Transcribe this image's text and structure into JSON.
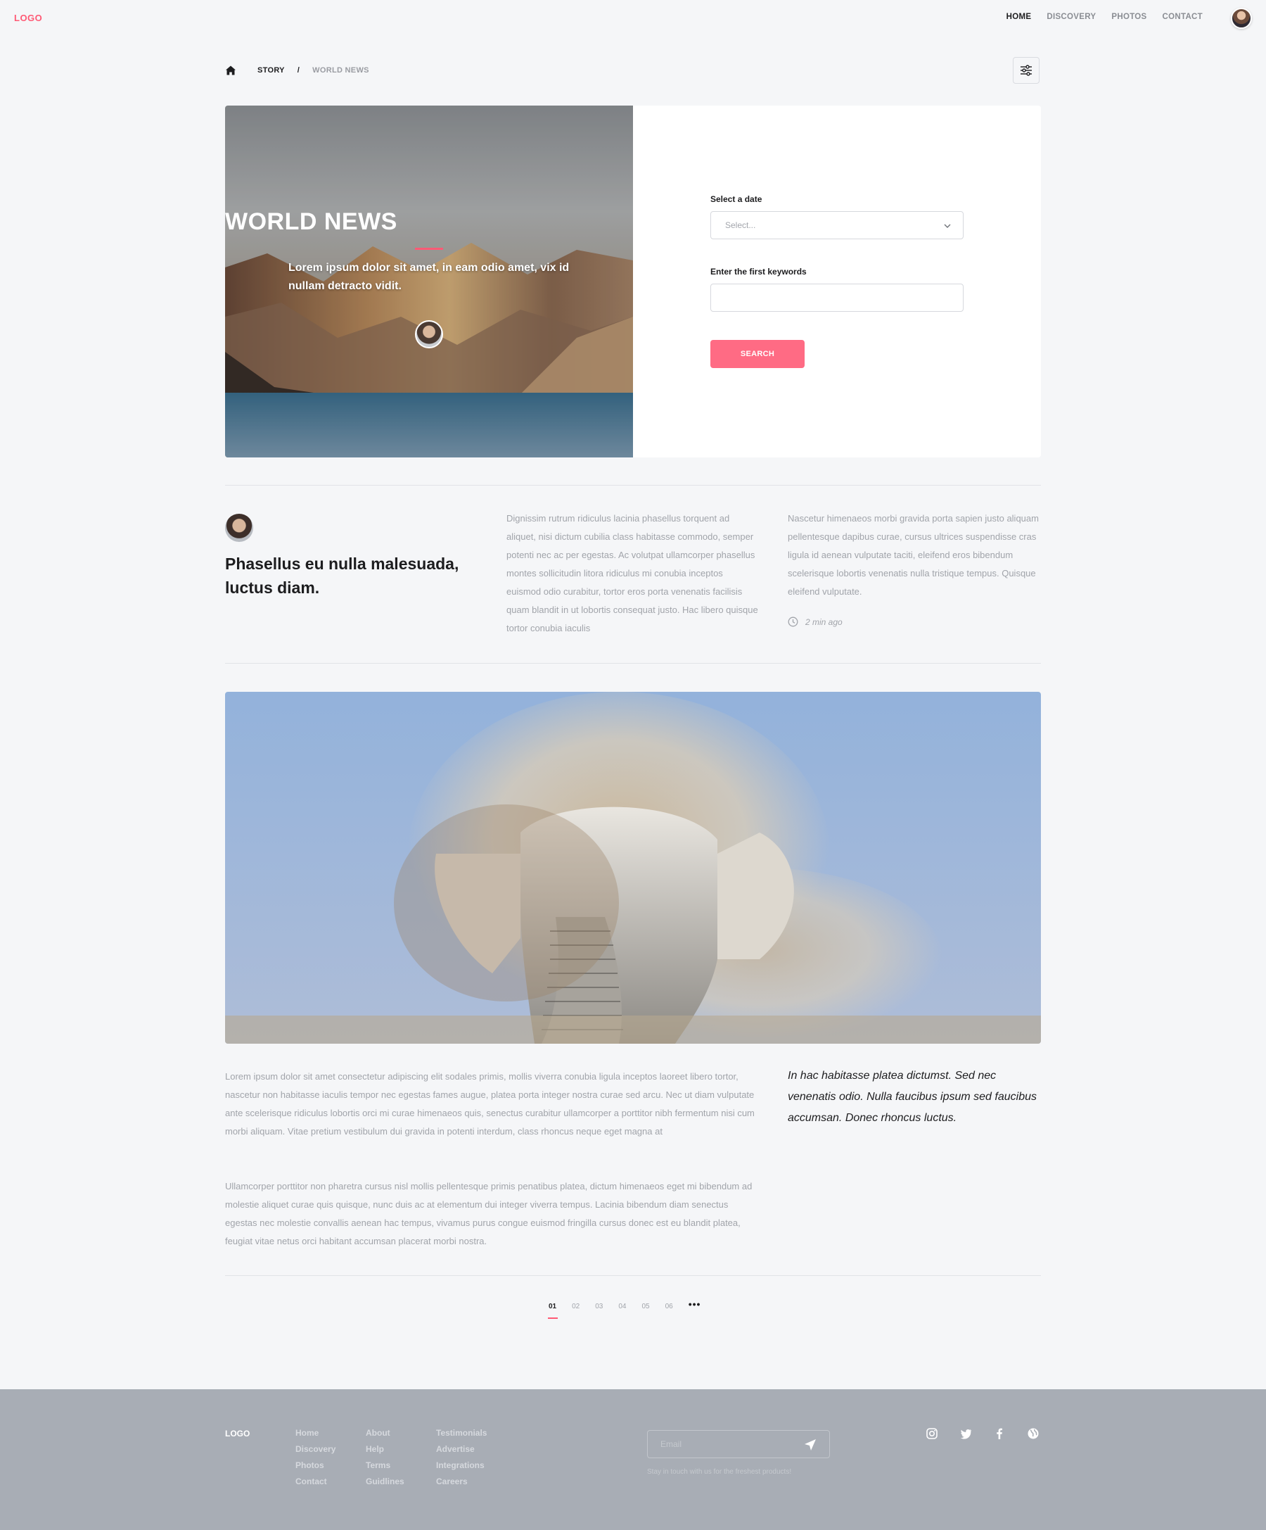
{
  "header": {
    "logo": "LOGO",
    "nav": [
      "HOME",
      "DISCOVERY",
      "PHOTOS",
      "CONTACT"
    ],
    "active_nav": "HOME"
  },
  "breadcrumb": {
    "items": [
      "STORY",
      "/",
      "WORLD NEWS"
    ]
  },
  "hero": {
    "title": "WORLD NEWS",
    "subtitle": "Lorem ipsum dolor sit amet, in eam odio amet, vix id nullam detracto vidit."
  },
  "search_form": {
    "date_label": "Select a date",
    "date_placeholder": "Select...",
    "keywords_label": "Enter the first keywords",
    "keywords_value": "",
    "search_button": "SEARCH"
  },
  "article": {
    "title": "Phasellus eu nulla malesuada, luctus diam.",
    "col1": "Dignissim rutrum ridiculus lacinia phasellus torquent ad aliquet, nisi dictum cubilia class habitasse commodo, semper potenti nec ac per egestas. Ac volutpat ullamcorper phasellus montes sollicitudin litora ridiculus mi conubia inceptos euismod odio curabitur, tortor eros porta venenatis facilisis quam blandit in ut lobortis consequat justo. Hac libero quisque tortor conubia iaculis",
    "col2": "Nascetur himenaeos morbi gravida porta sapien justo aliquam pellentesque dapibus curae, cursus ultrices suspendisse cras ligula id aenean vulputate taciti, eleifend eros bibendum scelerisque lobortis venenatis nulla tristique tempus. Quisque eleifend vulputate.",
    "time": "2 min ago"
  },
  "body": {
    "para1": "Lorem ipsum dolor sit amet consectetur adipiscing elit sodales primis, mollis viverra conubia ligula inceptos laoreet libero tortor, nascetur non habitasse iaculis tempor nec egestas fames augue, platea porta integer nostra curae sed arcu. Nec ut diam vulputate ante scelerisque ridiculus lobortis orci mi curae himenaeos quis, senectus curabitur ullamcorper a porttitor nibh fermentum nisi cum morbi aliquam. Vitae pretium vestibulum dui gravida in potenti interdum, class rhoncus neque eget magna at",
    "para2": "Ullamcorper porttitor non pharetra cursus nisl mollis pellentesque primis penatibus platea, dictum himenaeos eget mi bibendum ad molestie aliquet curae quis quisque, nunc duis ac at elementum dui integer viverra tempus. Lacinia bibendum diam senectus egestas nec molestie convallis aenean hac tempus, vivamus purus congue euismod fringilla cursus donec est eu blandit platea, feugiat vitae netus orci habitant accumsan placerat morbi nostra.",
    "quote": "In hac habitasse platea dictumst. Sed nec venenatis odio. Nulla faucibus ipsum sed faucibus accumsan. Donec rhoncus luctus."
  },
  "pagination": {
    "pages": [
      "01",
      "02",
      "03",
      "04",
      "05",
      "06"
    ],
    "more": "•••",
    "current": "01"
  },
  "footer": {
    "logo": "LOGO",
    "col1": [
      "Home",
      "Discovery",
      "Photos",
      "Contact"
    ],
    "col2": [
      "About",
      "Help",
      "Terms",
      "Guidlines"
    ],
    "col3": [
      "Testimonials",
      "Advertise",
      "Integrations",
      "Careers"
    ],
    "email_placeholder": "Email",
    "note": "Stay in touch with us for the freshest products!",
    "social": [
      "instagram-icon",
      "twitter-icon",
      "facebook-icon",
      "globe-icon"
    ]
  },
  "colors": {
    "accent": "#ff5a75",
    "button": "#ff6b84",
    "footer_bg": "#a8adb5",
    "page_bg": "#f5f6f8"
  }
}
